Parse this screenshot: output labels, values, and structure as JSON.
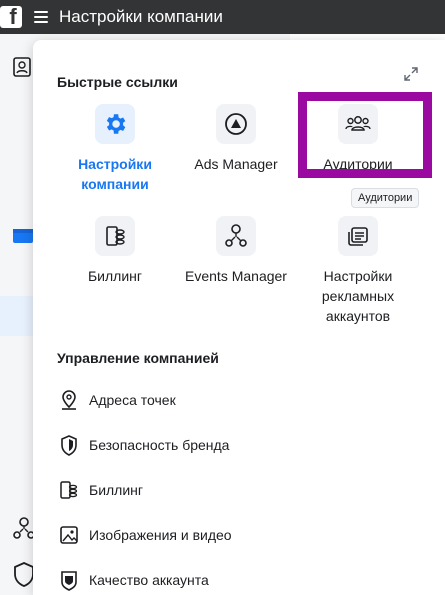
{
  "topbar": {
    "title": "Настройки компании",
    "logo": "f"
  },
  "quick_links": {
    "title": "Быстрые ссылки",
    "tiles": [
      {
        "label": "Настройки компании",
        "icon": "gear-icon",
        "active": true
      },
      {
        "label": "Ads Manager",
        "icon": "ads-manager-icon",
        "active": false
      },
      {
        "label": "Аудитории",
        "icon": "audience-icon",
        "active": false
      },
      {
        "label": "Биллинг",
        "icon": "billing-icon",
        "active": false
      },
      {
        "label": "Events Manager",
        "icon": "events-icon",
        "active": false
      },
      {
        "label": "Настройки рекламных аккаунтов",
        "icon": "ad-accounts-icon",
        "active": false
      }
    ],
    "tooltip": "Аудитории"
  },
  "management": {
    "title": "Управление компанией",
    "items": [
      {
        "label": "Адреса точек",
        "icon": "location-pin-icon"
      },
      {
        "label": "Безопасность бренда",
        "icon": "shield-icon"
      },
      {
        "label": "Биллинг",
        "icon": "billing-icon"
      },
      {
        "label": "Изображения и видео",
        "icon": "media-icon"
      },
      {
        "label": "Качество аккаунта",
        "icon": "account-quality-icon"
      }
    ]
  },
  "colors": {
    "accent": "#1877f2",
    "highlight": "#9b0aa0",
    "topbar": "#323436"
  }
}
